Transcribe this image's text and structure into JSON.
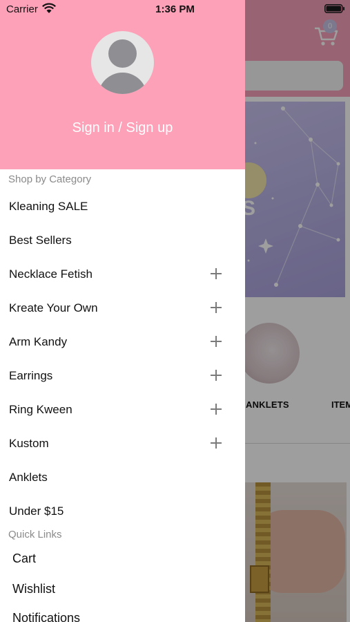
{
  "status_bar": {
    "carrier": "Carrier",
    "time": "1:36 PM"
  },
  "background": {
    "cart_badge": "0",
    "banner_text": "S",
    "category_labels": [
      "ANKLETS",
      "ITEM"
    ]
  },
  "drawer": {
    "auth_link": "Sign in / Sign up",
    "shop_section_title": "Shop by Category",
    "categories": [
      {
        "label": "Kleaning SALE",
        "expandable": false
      },
      {
        "label": "Best Sellers",
        "expandable": false
      },
      {
        "label": "Necklace Fetish",
        "expandable": true
      },
      {
        "label": "Kreate Your Own",
        "expandable": true
      },
      {
        "label": "Arm Kandy",
        "expandable": true
      },
      {
        "label": "Earrings",
        "expandable": true
      },
      {
        "label": "Ring Kween",
        "expandable": true
      },
      {
        "label": "Kustom",
        "expandable": true
      },
      {
        "label": "Anklets",
        "expandable": false
      },
      {
        "label": "Under $15",
        "expandable": false
      }
    ],
    "quick_section_title": "Quick Links",
    "quick_links": [
      {
        "label": "Cart"
      },
      {
        "label": "Wishlist"
      },
      {
        "label": "Notifications"
      }
    ]
  },
  "colors": {
    "header_pink": "#fda1b8",
    "background_pink": "#f6a1b8",
    "text": "#111111",
    "section_gray": "#8a8a8a"
  }
}
